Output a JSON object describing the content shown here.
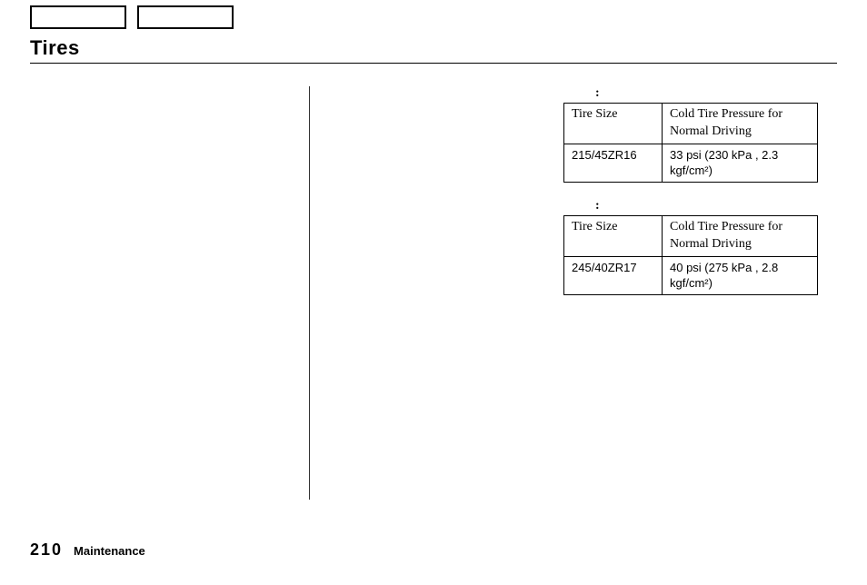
{
  "title": "Tires",
  "tables": [
    {
      "label": ":",
      "headers": {
        "size": "Tire Size",
        "pressure": "Cold Tire Pressure for Normal Driving"
      },
      "row": {
        "size": "215/45ZR16",
        "pressure": "33 psi (230 kPa , 2.3 kgf/cm²)"
      }
    },
    {
      "label": ":",
      "headers": {
        "size": "Tire Size",
        "pressure": "Cold Tire Pressure for Normal Driving"
      },
      "row": {
        "size": "245/40ZR17",
        "pressure": "40 psi (275 kPa , 2.8 kgf/cm²)"
      }
    }
  ],
  "footer": {
    "page_number": "210",
    "section": "Maintenance"
  }
}
